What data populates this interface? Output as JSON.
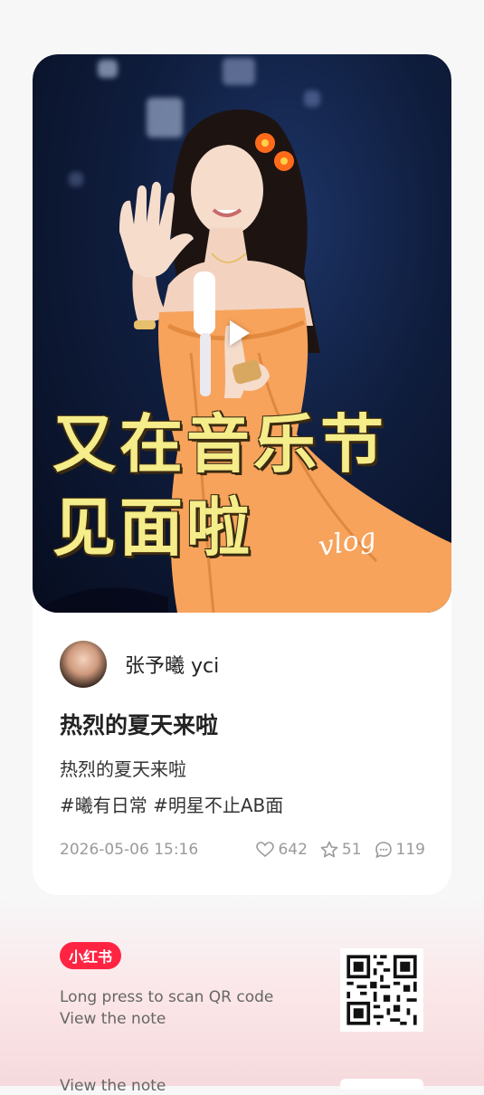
{
  "cover": {
    "title_line1": "又在音乐节",
    "title_line2": "见面啦",
    "tag": "vlog",
    "play_icon": "play-icon"
  },
  "author": {
    "name": "张予曦 yci"
  },
  "post": {
    "title": "热烈的夏天来啦",
    "body": "热烈的夏天来啦",
    "tags": "#曦有日常 #明星不止AB面",
    "date": "2026-05-06 15:16",
    "likes": "642",
    "collects": "51",
    "comments": "119"
  },
  "share": {
    "logo": "小红书",
    "scan_line1": "Long press to scan QR code",
    "scan_line2": "View the note",
    "scan_line2_repeat": "View the note"
  },
  "colors": {
    "brand": "#ff2442",
    "cover_yellow": "#f5ec8a",
    "dress_orange": "#f7a35c"
  }
}
